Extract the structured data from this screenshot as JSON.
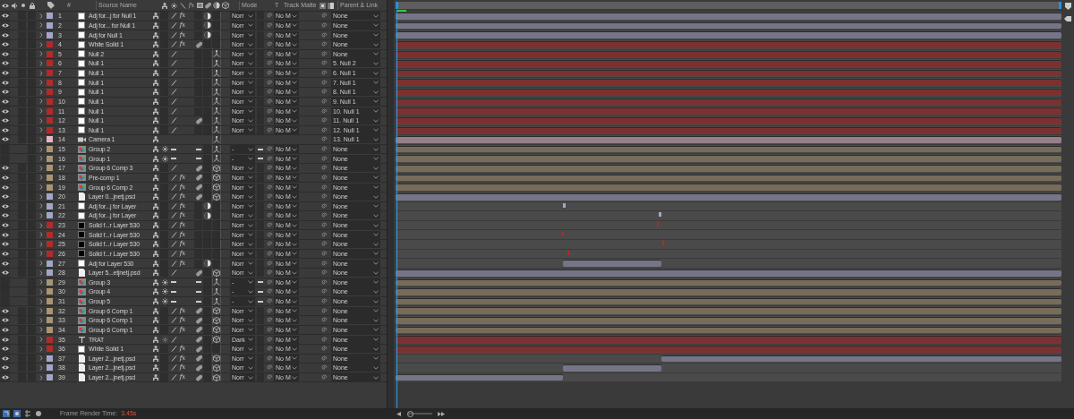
{
  "header": {
    "number": "#",
    "source_name": "Source Name",
    "fx": "fx",
    "mode": "Mode",
    "t": "T",
    "track_matte": "Track Matte",
    "parent": "Parent & Link"
  },
  "rows": [
    {
      "visible": true,
      "color": "#a5a5c8",
      "number": "1",
      "source": {
        "kind": "solid-white"
      },
      "name": "Adj for...j for Null 1",
      "quality": {
        "kind": "line"
      },
      "collapse": false,
      "fx": "fx",
      "adjustment": true,
      "mode": "Norr",
      "preserve": false,
      "matte": "No M",
      "parent": "None"
    },
    {
      "visible": true,
      "color": "#a5a5c8",
      "number": "2",
      "source": {
        "kind": "solid-white"
      },
      "name": "Adj for... for Null 1",
      "quality": {
        "kind": "line"
      },
      "collapse": false,
      "fx": "fx",
      "adjustment": true,
      "mode": "Norr",
      "preserve": false,
      "matte": "No M",
      "parent": "None"
    },
    {
      "visible": true,
      "color": "#a5a5c8",
      "number": "3",
      "source": {
        "kind": "solid-white"
      },
      "name": "Adj for Null 1",
      "quality": {
        "kind": "line"
      },
      "collapse": false,
      "fx": "fx",
      "adjustment": true,
      "mode": "Norr",
      "preserve": false,
      "matte": "No M",
      "parent": "None"
    },
    {
      "visible": true,
      "color": "#b22a2a",
      "number": "4",
      "source": {
        "kind": "solid-white"
      },
      "name": "White Solid 1",
      "quality": {
        "kind": "line"
      },
      "collapse": false,
      "fx": "fx",
      "frame_blend": {
        "kind": "pill"
      },
      "adjustment": false,
      "mode": "Norr",
      "preserve": false,
      "matte": "No M",
      "parent": "None"
    },
    {
      "visible": true,
      "color": "#b22a2a",
      "number": "5",
      "source": {
        "kind": "solid-white"
      },
      "name": "Null 2",
      "quality": {
        "kind": "line"
      },
      "collapse": false,
      "adjustment": false,
      "three_d": {
        "kind": "axes"
      },
      "mode": "Norr",
      "preserve": false,
      "matte": "No M",
      "parent": "None"
    },
    {
      "visible": true,
      "color": "#b22a2a",
      "number": "6",
      "source": {
        "kind": "solid-white"
      },
      "name": "Null 1",
      "quality": {
        "kind": "line"
      },
      "collapse": false,
      "adjustment": false,
      "three_d": {
        "kind": "axes"
      },
      "mode": "Norr",
      "preserve": false,
      "matte": "No M",
      "parent": "5. Null 2"
    },
    {
      "visible": true,
      "color": "#b22a2a",
      "number": "7",
      "source": {
        "kind": "solid-white"
      },
      "name": "Null 1",
      "quality": {
        "kind": "line"
      },
      "collapse": false,
      "adjustment": false,
      "three_d": {
        "kind": "axes"
      },
      "mode": "Norr",
      "preserve": false,
      "matte": "No M",
      "parent": "6. Null 1"
    },
    {
      "visible": true,
      "color": "#b22a2a",
      "number": "8",
      "source": {
        "kind": "solid-white"
      },
      "name": "Null 1",
      "quality": {
        "kind": "line"
      },
      "collapse": false,
      "adjustment": false,
      "three_d": {
        "kind": "axes"
      },
      "mode": "Norr",
      "preserve": false,
      "matte": "No M",
      "parent": "7. Null 1"
    },
    {
      "visible": true,
      "color": "#b22a2a",
      "number": "9",
      "source": {
        "kind": "solid-white"
      },
      "name": "Null 1",
      "quality": {
        "kind": "line"
      },
      "collapse": false,
      "adjustment": false,
      "three_d": {
        "kind": "axes"
      },
      "mode": "Norr",
      "preserve": false,
      "matte": "No M",
      "parent": "8. Null 1"
    },
    {
      "visible": true,
      "color": "#b22a2a",
      "number": "10",
      "source": {
        "kind": "solid-white"
      },
      "name": "Null 1",
      "quality": {
        "kind": "line"
      },
      "collapse": false,
      "adjustment": false,
      "three_d": {
        "kind": "axes"
      },
      "mode": "Norr",
      "preserve": false,
      "matte": "No M",
      "parent": "9. Null 1"
    },
    {
      "visible": true,
      "color": "#b22a2a",
      "number": "11",
      "source": {
        "kind": "solid-white"
      },
      "name": "Null 1",
      "quality": {
        "kind": "line"
      },
      "collapse": false,
      "adjustment": false,
      "three_d": {
        "kind": "axes"
      },
      "mode": "Norr",
      "preserve": false,
      "matte": "No M",
      "parent": "10. Null 1"
    },
    {
      "visible": true,
      "color": "#b22a2a",
      "number": "12",
      "source": {
        "kind": "solid-white"
      },
      "name": "Null 1",
      "quality": {
        "kind": "line"
      },
      "collapse": false,
      "frame_blend": {
        "kind": "pill"
      },
      "adjustment": false,
      "three_d": {
        "kind": "axes"
      },
      "mode": "Norr",
      "preserve": false,
      "matte": "No M",
      "parent": "11. Null 1"
    },
    {
      "visible": true,
      "color": "#b22a2a",
      "number": "13",
      "source": {
        "kind": "solid-white"
      },
      "name": "Null 1",
      "quality": {
        "kind": "line"
      },
      "collapse": false,
      "adjustment": false,
      "three_d": {
        "kind": "axes"
      },
      "mode": "Norr",
      "preserve": false,
      "matte": "No M",
      "parent": "12. Null 1"
    },
    {
      "visible": true,
      "color": "#e0b8c8",
      "number": "14",
      "source": {
        "kind": "camera"
      },
      "name": "Camera 1",
      "three_d": {
        "kind": "axes"
      },
      "parent": "13. Null 1"
    },
    {
      "visible": false,
      "color": "#a99574",
      "number": "15",
      "source": {
        "kind": "comp"
      },
      "name": "Group 2",
      "quality": {
        "kind": "dash"
      },
      "collapse": true,
      "frame_blend": {
        "kind": "dash"
      },
      "adjustment": false,
      "three_d": {
        "kind": "axes"
      },
      "mode": "-",
      "preserve": true,
      "matte": "No M",
      "parent": "None"
    },
    {
      "visible": false,
      "color": "#a99574",
      "number": "16",
      "source": {
        "kind": "comp"
      },
      "name": "Group 1",
      "quality": {
        "kind": "dash"
      },
      "collapse": true,
      "frame_blend": {
        "kind": "dash"
      },
      "adjustment": false,
      "three_d": {
        "kind": "axes"
      },
      "mode": "-",
      "preserve": true,
      "matte": "No M",
      "parent": "None"
    },
    {
      "visible": true,
      "color": "#a99574",
      "number": "17",
      "source": {
        "kind": "comp"
      },
      "name": "Group 6 Comp 3",
      "quality": {
        "kind": "line"
      },
      "collapse": false,
      "frame_blend": {
        "kind": "pill"
      },
      "adjustment": false,
      "three_d": {
        "kind": "cube"
      },
      "mode": "Norr",
      "preserve": false,
      "matte": "No M",
      "parent": "None"
    },
    {
      "visible": true,
      "color": "#a99574",
      "number": "18",
      "source": {
        "kind": "comp"
      },
      "name": "Pre-comp 1",
      "quality": {
        "kind": "line"
      },
      "collapse": false,
      "fx": "fx",
      "frame_blend": {
        "kind": "pill"
      },
      "adjustment": false,
      "three_d": {
        "kind": "cube"
      },
      "mode": "Norr",
      "preserve": false,
      "matte": "No M",
      "parent": "None"
    },
    {
      "visible": true,
      "color": "#a99574",
      "number": "19",
      "source": {
        "kind": "comp"
      },
      "name": "Group 6 Comp 2",
      "quality": {
        "kind": "line"
      },
      "collapse": false,
      "fx": "fx",
      "frame_blend": {
        "kind": "pill"
      },
      "adjustment": false,
      "three_d": {
        "kind": "cube"
      },
      "mode": "Norr",
      "preserve": false,
      "matte": "No M",
      "parent": "None"
    },
    {
      "visible": true,
      "color": "#a5a5c8",
      "number": "20",
      "source": {
        "kind": "footage"
      },
      "name": "Layer 0...jnetj.psd",
      "quality": {
        "kind": "line"
      },
      "collapse": false,
      "fx": "fx",
      "frame_blend": {
        "kind": "pill"
      },
      "adjustment": false,
      "three_d": {
        "kind": "cube"
      },
      "mode": "Norr",
      "preserve": false,
      "matte": "No M",
      "parent": "None"
    },
    {
      "visible": true,
      "color": "#a5a5c8",
      "number": "21",
      "source": {
        "kind": "solid-white"
      },
      "name": "Adj for...j for Layer",
      "quality": {
        "kind": "line"
      },
      "collapse": false,
      "fx": "fx",
      "adjustment": true,
      "mode": "Norr",
      "preserve": false,
      "matte": "No M",
      "parent": "None"
    },
    {
      "visible": true,
      "color": "#a5a5c8",
      "number": "22",
      "source": {
        "kind": "solid-white"
      },
      "name": "Adj for...j for Layer",
      "quality": {
        "kind": "line"
      },
      "collapse": false,
      "fx": "fx",
      "adjustment": true,
      "mode": "Norr",
      "preserve": false,
      "matte": "No M",
      "parent": "None"
    },
    {
      "visible": true,
      "color": "#b22a2a",
      "number": "23",
      "source": {
        "kind": "solid-black"
      },
      "name": "Solid f...r Layer 530",
      "quality": {
        "kind": "line"
      },
      "collapse": false,
      "fx": "fx",
      "adjustment": false,
      "mode": "Norr",
      "preserve": false,
      "matte": "No M",
      "parent": "None"
    },
    {
      "visible": true,
      "color": "#b22a2a",
      "number": "24",
      "source": {
        "kind": "solid-black"
      },
      "name": "Solid f...r Layer 530",
      "quality": {
        "kind": "line"
      },
      "collapse": false,
      "fx": "fx",
      "adjustment": false,
      "mode": "Norr",
      "preserve": false,
      "matte": "No M",
      "parent": "None"
    },
    {
      "visible": true,
      "color": "#b22a2a",
      "number": "25",
      "source": {
        "kind": "solid-black"
      },
      "name": "Solid f...r Layer 530",
      "quality": {
        "kind": "line"
      },
      "collapse": false,
      "fx": "fx",
      "adjustment": false,
      "mode": "Norr",
      "preserve": false,
      "matte": "No M",
      "parent": "None"
    },
    {
      "visible": true,
      "color": "#b22a2a",
      "number": "26",
      "source": {
        "kind": "solid-black"
      },
      "name": "Solid f...r Layer 530",
      "quality": {
        "kind": "line"
      },
      "collapse": false,
      "fx": "fx",
      "adjustment": false,
      "mode": "Norr",
      "preserve": false,
      "matte": "No M",
      "parent": "None"
    },
    {
      "visible": true,
      "color": "#a5a5c8",
      "number": "27",
      "source": {
        "kind": "solid-white"
      },
      "name": "Adj for Layer 530",
      "quality": {
        "kind": "line"
      },
      "collapse": false,
      "fx": "fx",
      "adjustment": true,
      "mode": "Norr",
      "preserve": false,
      "matte": "No M",
      "parent": "None"
    },
    {
      "visible": true,
      "color": "#a5a5c8",
      "number": "28",
      "source": {
        "kind": "footage"
      },
      "name": "Layer 5...etjnetj.psd",
      "quality": {
        "kind": "line"
      },
      "collapse": false,
      "frame_blend": {
        "kind": "pill"
      },
      "adjustment": false,
      "three_d": {
        "kind": "cube"
      },
      "mode": "Norr",
      "preserve": false,
      "matte": "No M",
      "parent": "None"
    },
    {
      "visible": false,
      "color": "#a99574",
      "number": "29",
      "source": {
        "kind": "comp"
      },
      "name": "Group 3",
      "quality": {
        "kind": "dash"
      },
      "collapse": true,
      "frame_blend": {
        "kind": "dash"
      },
      "adjustment": false,
      "three_d": {
        "kind": "axes"
      },
      "mode": "-",
      "preserve": true,
      "matte": "No M",
      "parent": "None"
    },
    {
      "visible": false,
      "color": "#a99574",
      "number": "30",
      "source": {
        "kind": "comp"
      },
      "name": "Group 4",
      "quality": {
        "kind": "dash"
      },
      "collapse": true,
      "frame_blend": {
        "kind": "dash"
      },
      "adjustment": false,
      "three_d": {
        "kind": "axes"
      },
      "mode": "-",
      "preserve": true,
      "matte": "No M",
      "parent": "None"
    },
    {
      "visible": false,
      "color": "#a99574",
      "number": "31",
      "source": {
        "kind": "comp"
      },
      "name": "Group 5",
      "quality": {
        "kind": "dash"
      },
      "collapse": true,
      "frame_blend": {
        "kind": "dash"
      },
      "adjustment": false,
      "three_d": {
        "kind": "axes"
      },
      "mode": "-",
      "preserve": true,
      "matte": "No M",
      "parent": "None"
    },
    {
      "visible": true,
      "color": "#a99574",
      "number": "32",
      "source": {
        "kind": "comp"
      },
      "name": "Group 6 Comp 1",
      "quality": {
        "kind": "line"
      },
      "collapse": false,
      "fx": "fx",
      "frame_blend": {
        "kind": "pill"
      },
      "adjustment": false,
      "three_d": {
        "kind": "cube"
      },
      "mode": "Norr",
      "preserve": false,
      "matte": "No M",
      "parent": "None"
    },
    {
      "visible": true,
      "color": "#a99574",
      "number": "33",
      "source": {
        "kind": "comp"
      },
      "name": "Group 6 Comp 1",
      "quality": {
        "kind": "line"
      },
      "collapse": false,
      "fx": "fx",
      "frame_blend": {
        "kind": "pill"
      },
      "adjustment": false,
      "three_d": {
        "kind": "cube"
      },
      "mode": "Norr",
      "preserve": false,
      "matte": "No M",
      "parent": "None"
    },
    {
      "visible": true,
      "color": "#a99574",
      "number": "34",
      "source": {
        "kind": "comp"
      },
      "name": "Group 6 Comp 1",
      "quality": {
        "kind": "line"
      },
      "collapse": false,
      "fx": "fx",
      "frame_blend": {
        "kind": "pill"
      },
      "adjustment": false,
      "three_d": {
        "kind": "cube"
      },
      "mode": "Norr",
      "preserve": false,
      "matte": "No M",
      "parent": "None"
    },
    {
      "visible": true,
      "color": "#b22a2a",
      "number": "35",
      "source": {
        "kind": "text"
      },
      "name": "TRAT",
      "quality": {
        "kind": "line"
      },
      "collapse": true,
      "frame_blend": {
        "kind": "pill"
      },
      "adjustment": false,
      "three_d": {
        "kind": "cube"
      },
      "mode": "Dark",
      "preserve": false,
      "matte": "No M",
      "parent": "None"
    },
    {
      "visible": true,
      "color": "#b22a2a",
      "number": "36",
      "source": {
        "kind": "solid-white"
      },
      "name": "White Solid 1",
      "quality": {
        "kind": "line"
      },
      "collapse": false,
      "fx": "fx",
      "frame_blend": {
        "kind": "pill"
      },
      "adjustment": false,
      "mode": "Norr",
      "preserve": false,
      "matte": "No M",
      "parent": "None"
    },
    {
      "visible": true,
      "color": "#a5a5c8",
      "number": "37",
      "source": {
        "kind": "footage"
      },
      "name": "Layer 2...jnetj.psd",
      "quality": {
        "kind": "line"
      },
      "collapse": false,
      "fx": "fx",
      "frame_blend": {
        "kind": "pill"
      },
      "adjustment": false,
      "three_d": {
        "kind": "cube"
      },
      "mode": "Norr",
      "preserve": false,
      "matte": "No M",
      "parent": "None"
    },
    {
      "visible": true,
      "color": "#a5a5c8",
      "number": "38",
      "source": {
        "kind": "footage"
      },
      "name": "Layer 2...jnetj.psd",
      "quality": {
        "kind": "line"
      },
      "collapse": false,
      "fx": "fx",
      "frame_blend": {
        "kind": "pill"
      },
      "adjustment": false,
      "three_d": {
        "kind": "cube"
      },
      "mode": "Norr",
      "preserve": false,
      "matte": "No M",
      "parent": "None"
    },
    {
      "visible": true,
      "color": "#a5a5c8",
      "number": "39",
      "source": {
        "kind": "footage"
      },
      "name": "Layer 2...jnetj.psd",
      "quality": {
        "kind": "line"
      },
      "collapse": false,
      "fx": "fx",
      "frame_blend": {
        "kind": "pill"
      },
      "adjustment": false,
      "three_d": {
        "kind": "cube"
      },
      "mode": "Norr",
      "preserve": false,
      "matte": "No M",
      "parent": "None"
    }
  ],
  "status_bar": {
    "label": "Frame Render Time:",
    "value": "3.45s",
    "zoom_slider": {
      "level": 0
    }
  }
}
